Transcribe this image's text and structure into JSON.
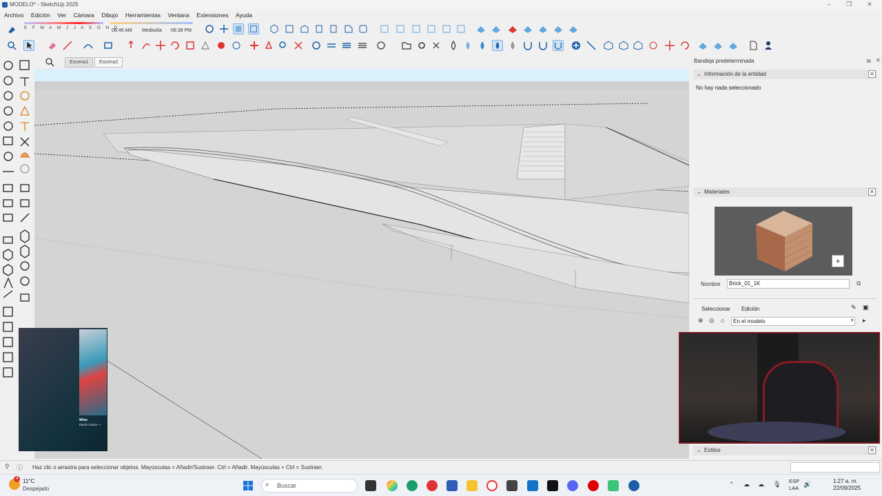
{
  "window": {
    "title": "MODELO* - SketchUp 2025"
  },
  "menu": [
    "Archivo",
    "Edición",
    "Ver",
    "Cámara",
    "Dibujo",
    "Herramientas",
    "Ventana",
    "Extensiones",
    "Ayuda"
  ],
  "shadows": {
    "months": "E F M A M J J A S O N D",
    "sunrise": "06:46 AM",
    "midday": "Mediodía",
    "sunset": "06:38 PM"
  },
  "scenes": {
    "tabs": [
      "Escena1",
      "Escena2"
    ],
    "active": "Escena2"
  },
  "tray": {
    "title": "Bandeja predeterminada",
    "entity_info": {
      "header": "Información de la entidad",
      "message": "No hay nada seleccionado"
    },
    "materials": {
      "header": "Materiales",
      "name_label": "Nombre",
      "name_value": "Brick_01_1K",
      "tab_select": "Seleccionar",
      "tab_edit": "Edición",
      "collection": "En el modelo"
    },
    "styles": {
      "header": "Estilos"
    }
  },
  "status": {
    "hint": "Haz clic o arrastra para seleccionar objetos. Mayúsculas = Añadir/Sustraer. Ctrl = Añadir. Mayúsculas + Ctrl = Sustraer."
  },
  "media": {
    "track": "Wios",
    "artist": "Martín Garrix —"
  },
  "taskbar": {
    "weather_temp": "11°C",
    "weather_desc": "Despejado",
    "search_placeholder": "Buscar",
    "lang": "ESP",
    "lang_sub": "LAA",
    "time": "1:27 a. m.",
    "date": "22/09/2025",
    "weather_badge": "4"
  },
  "colors": {
    "accent": "#1b5fa8",
    "tray_bg": "#f0f0f0",
    "viewport": "#d4d4d4",
    "sky": "#d9f1fb",
    "webcam_border": "#7a1620"
  }
}
